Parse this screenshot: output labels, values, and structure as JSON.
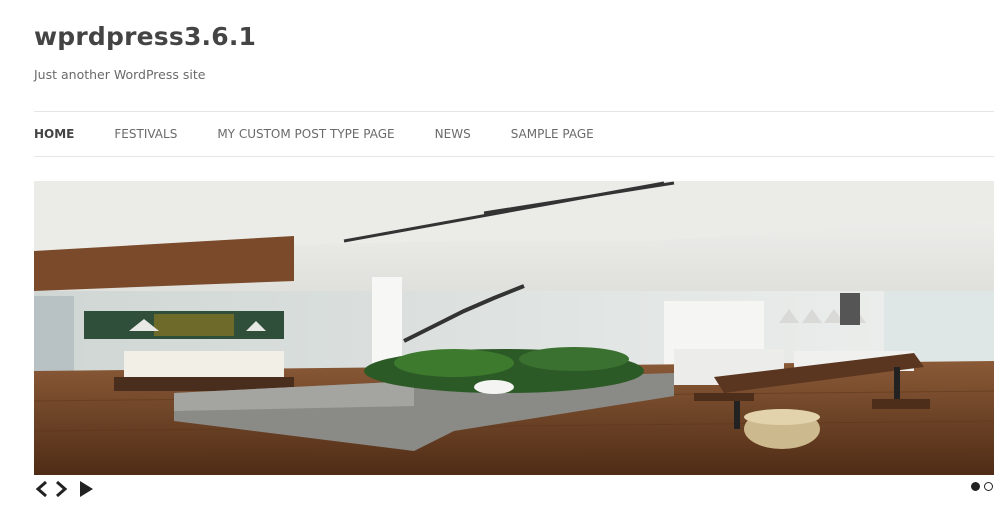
{
  "site": {
    "title": "wprdpress3.6.1",
    "tagline": "Just another WordPress site"
  },
  "nav": {
    "items": [
      {
        "label": "HOME",
        "active": true
      },
      {
        "label": "FESTIVALS",
        "active": false
      },
      {
        "label": "MY CUSTOM POST TYPE PAGE",
        "active": false
      },
      {
        "label": "NEWS",
        "active": false
      },
      {
        "label": "SAMPLE PAGE",
        "active": false
      }
    ]
  },
  "slider": {
    "image_icon": "interior-loft-photo",
    "controls": [
      "prev-icon",
      "next-icon",
      "play-icon"
    ],
    "slide_count": 2,
    "current_slide": 1
  },
  "colors": {
    "text_dark": "#444444",
    "text_muted": "#6a6a6a",
    "divider": "#e6e6e6"
  }
}
